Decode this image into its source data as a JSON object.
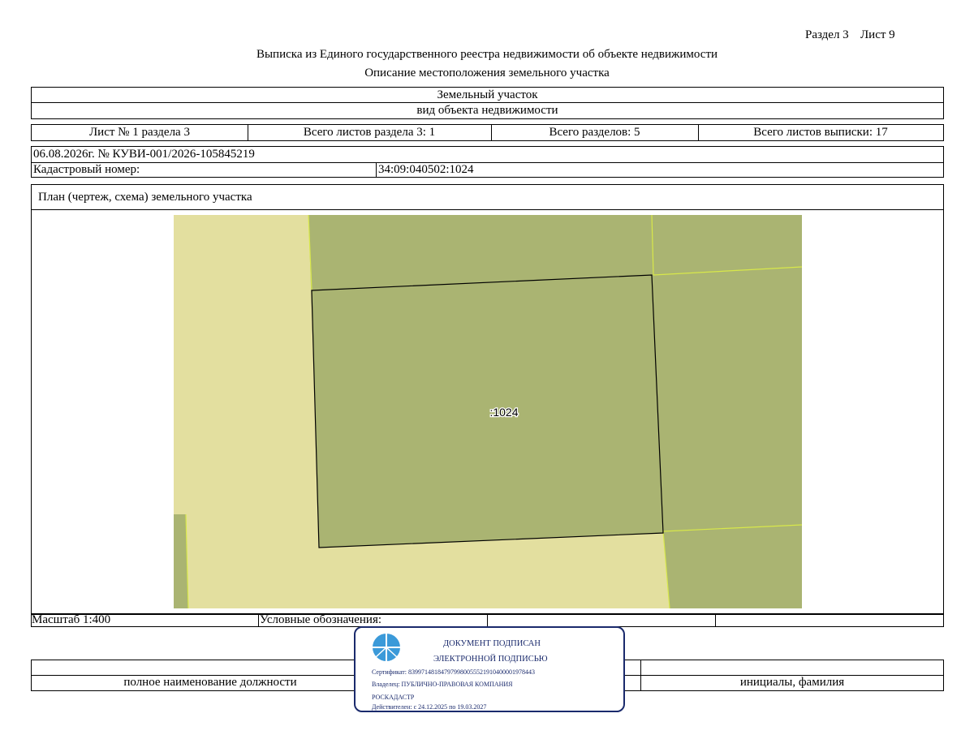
{
  "header": {
    "section": "Раздел 3",
    "sheet": "Лист 9",
    "title": "Выписка из Единого государственного реестра недвижимости об объекте недвижимости",
    "subtitle": "Описание местоположения земельного участка"
  },
  "object": {
    "type": "Земельный участок",
    "type_caption": "вид объекта недвижимости"
  },
  "counters": {
    "sheet_of_section": "Лист № 1 раздела 3",
    "total_sheets_section": "Всего листов раздела 3: 1",
    "total_sections": "Всего разделов: 5",
    "total_sheets": "Всего листов выписки: 17"
  },
  "record": {
    "date_number": "06.08.2026г. № КУВИ-001/2026-105845219",
    "cadastral_label": "Кадастровый номер:",
    "cadastral_value": "34:09:040502:1024"
  },
  "plan": {
    "title": "План (чертеж, схема) земельного участка",
    "parcel_label": ":1024",
    "colors": {
      "background": "#e3df9f",
      "neighbors": "#aab472",
      "boundary": "#d8e84a",
      "outline": "#000000"
    }
  },
  "footer": {
    "scale": "Масштаб 1:400",
    "legend": "Условные обозначения:",
    "position_caption": "полное наименование должности",
    "name_caption": "инициалы, фамилия"
  },
  "stamp": {
    "line1": "ДОКУМЕНТ ПОДПИСАН",
    "line2": "ЭЛЕКТРОННОЙ ПОДПИСЬЮ",
    "certificate": "Сертификат: 839971481847979980055521910400001978443",
    "owner": "Владелец: ПУБЛИЧНО-ПРАВОВАЯ КОМПАНИЯ",
    "owner2": "РОСКАДАСТР",
    "valid": "Действителен: с 24.12.2025 по 19.03.2027",
    "color": "#1a2a6c"
  }
}
